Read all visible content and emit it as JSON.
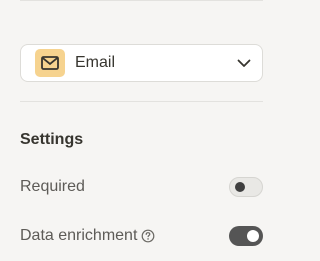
{
  "field_type": {
    "selected": "Email",
    "icon": "mail-icon",
    "icon_color": "#f6d38f"
  },
  "settings": {
    "heading": "Settings",
    "required": {
      "label": "Required",
      "enabled": false
    },
    "data_enrichment": {
      "label": "Data enrichment",
      "enabled": true,
      "help_icon": "question-circle-icon"
    }
  },
  "colors": {
    "background": "#f6f5f3",
    "toggle_on": "#555555",
    "toggle_off": "#e9e8e5"
  }
}
